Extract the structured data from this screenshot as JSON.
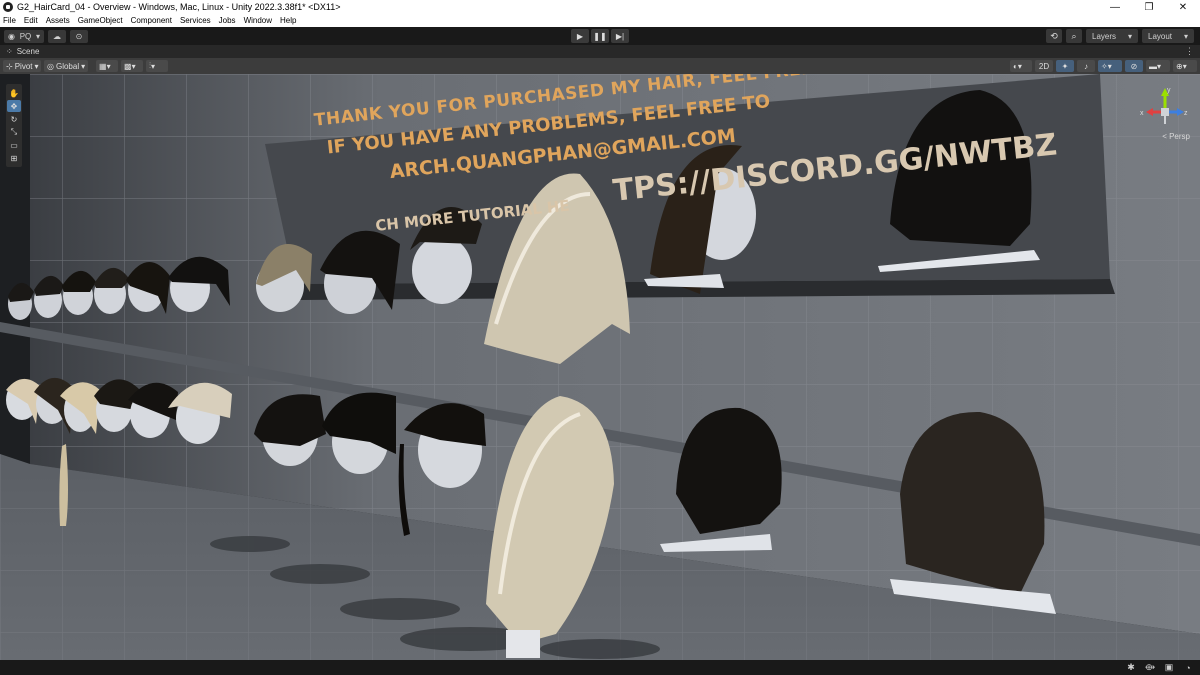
{
  "window": {
    "title": "G2_HairCard_04 - Overview - Windows, Mac, Linux - Unity 2022.3.38f1* <DX11>",
    "minimize": "—",
    "maximize": "❐",
    "close": "✕"
  },
  "menu": [
    "File",
    "Edit",
    "Assets",
    "GameObject",
    "Component",
    "Services",
    "Jobs",
    "Window",
    "Help"
  ],
  "toolbar": {
    "account": "PQ",
    "layers_label": "Layers",
    "layout_label": "Layout"
  },
  "scene_tab": {
    "label": "Scene"
  },
  "scene_toolbar": {
    "pivot": "Pivot",
    "global": "Global",
    "mode_2d": "2D"
  },
  "viewport": {
    "banner_lines": [
      "THANK YOU FOR PURCHASED MY HAIR, FEEL FREE TO",
      "IF YOU HAVE ANY PROBLEMS, FEEL FREE TO",
      "ARCH.QUANGPHAN@GMAIL.COM",
      "TPS://DISCORD.GG/NWTBZ",
      "CH MORE TUTORIAL HE"
    ],
    "persp_label": "< Persp",
    "gizmo": {
      "x": "x",
      "y": "y",
      "z": "z"
    }
  },
  "colors": {
    "editor_bg": "#191919",
    "panel": "#383838",
    "accent": "#4b7aa8",
    "banner_text": "#e0a55c",
    "wall": "#6a6e74",
    "floor": "#5d6167"
  }
}
